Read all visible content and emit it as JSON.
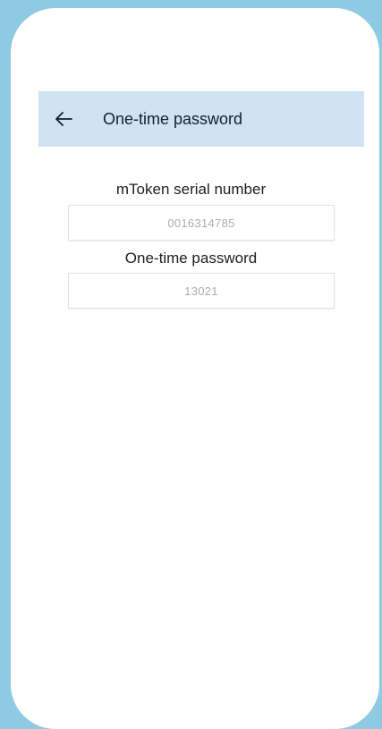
{
  "header": {
    "title": "One-time password",
    "back_icon": "arrow-left-icon"
  },
  "form": {
    "serial_label": "mToken serial number",
    "serial_value": "0016314785",
    "otp_label": "One-time password",
    "otp_value": "13021"
  },
  "colors": {
    "background": "#8ECAE1",
    "appbar": "#CFE3F4",
    "title_text": "#0F2033",
    "value_text": "#ADADAD"
  }
}
